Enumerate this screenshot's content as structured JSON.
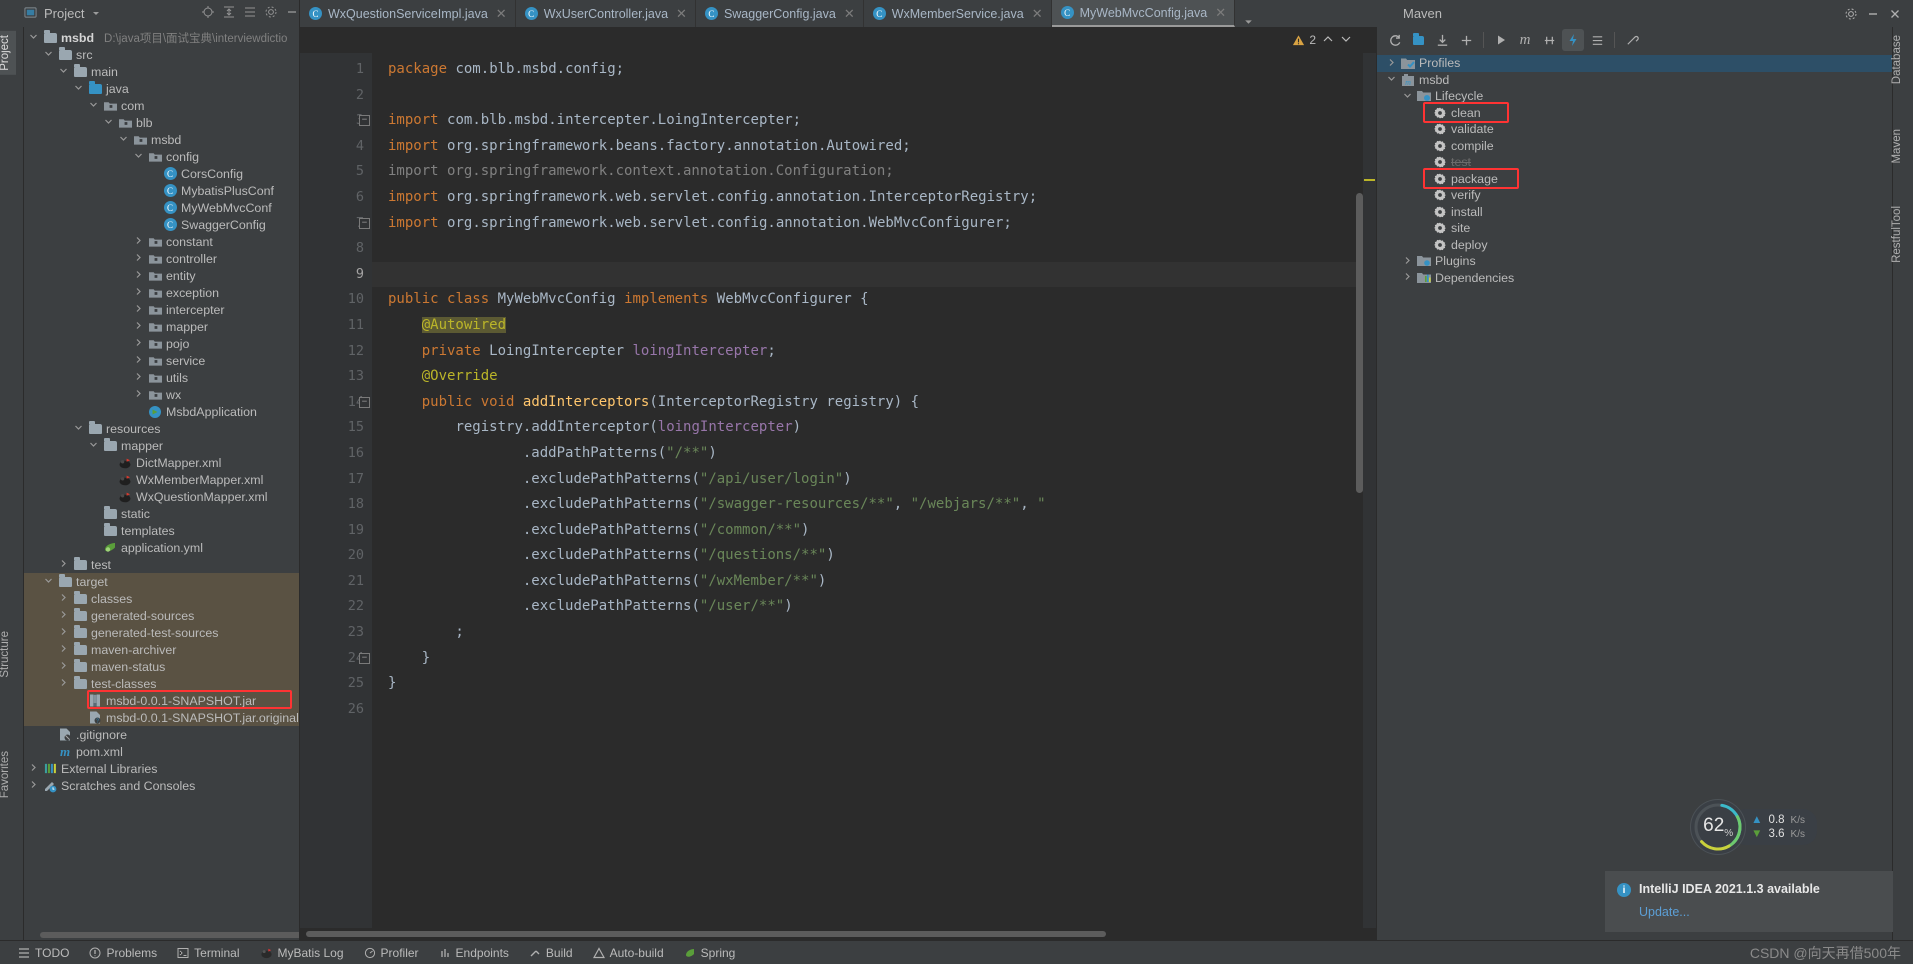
{
  "window": {
    "project_tool_title": "Project",
    "maven_tool_title": "Maven"
  },
  "project_toolbar": {
    "icons": [
      "locate-icon",
      "expand-all-icon",
      "collapse-all-icon",
      "settings-icon",
      "hide-icon"
    ]
  },
  "editor_tabs": [
    {
      "label": "WxQuestionServiceImpl.java",
      "active": false,
      "icon": "java-class-icon"
    },
    {
      "label": "WxUserController.java",
      "active": false,
      "icon": "java-class-icon"
    },
    {
      "label": "SwaggerConfig.java",
      "active": false,
      "icon": "java-class-icon"
    },
    {
      "label": "WxMemberService.java",
      "active": false,
      "icon": "java-interface-icon"
    },
    {
      "label": "MyWebMvcConfig.java",
      "active": true,
      "icon": "java-class-icon"
    }
  ],
  "editor": {
    "warning_count": "2",
    "lines": [
      {
        "n": "1",
        "current": false,
        "fold": null
      },
      {
        "n": "2",
        "current": false,
        "fold": null
      },
      {
        "n": "3",
        "current": false,
        "fold": "start"
      },
      {
        "n": "4",
        "current": false,
        "fold": null
      },
      {
        "n": "5",
        "current": false,
        "fold": null
      },
      {
        "n": "6",
        "current": false,
        "fold": null
      },
      {
        "n": "7",
        "current": false,
        "fold": "end"
      },
      {
        "n": "8",
        "current": false,
        "fold": null
      },
      {
        "n": "9",
        "current": true,
        "fold": null
      },
      {
        "n": "10",
        "current": false,
        "fold": null
      },
      {
        "n": "11",
        "current": false,
        "fold": null
      },
      {
        "n": "12",
        "current": false,
        "fold": null
      },
      {
        "n": "13",
        "current": false,
        "fold": null
      },
      {
        "n": "14",
        "current": false,
        "fold": "start"
      },
      {
        "n": "15",
        "current": false,
        "fold": null
      },
      {
        "n": "16",
        "current": false,
        "fold": null
      },
      {
        "n": "17",
        "current": false,
        "fold": null
      },
      {
        "n": "18",
        "current": false,
        "fold": null
      },
      {
        "n": "19",
        "current": false,
        "fold": null
      },
      {
        "n": "20",
        "current": false,
        "fold": null
      },
      {
        "n": "21",
        "current": false,
        "fold": null
      },
      {
        "n": "22",
        "current": false,
        "fold": null
      },
      {
        "n": "23",
        "current": false,
        "fold": null
      },
      {
        "n": "24",
        "current": false,
        "fold": "end"
      },
      {
        "n": "25",
        "current": false,
        "fold": null
      },
      {
        "n": "26",
        "current": false,
        "fold": null
      }
    ],
    "source_text": "package com.blb.msbd.config;\n\nimport com.blb.msbd.intercepter.LoingIntercepter;\nimport org.springframework.beans.factory.annotation.Autowired;\nimport org.springframework.context.annotation.Configuration;\nimport org.springframework.web.servlet.config.annotation.InterceptorRegistry;\nimport org.springframework.web.servlet.config.annotation.WebMvcConfigurer;\n\n\npublic class MyWebMvcConfig implements WebMvcConfigurer {\n    @Autowired\n    private LoingIntercepter loingIntercepter;\n    @Override\n    public void addInterceptors(InterceptorRegistry registry) {\n        registry.addInterceptor(loingIntercepter)\n                .addPathPatterns(\"/**\")\n                .excludePathPatterns(\"/api/user/login\")\n                .excludePathPatterns(\"/swagger-resources/**\", \"/webjars/**\", \"\n                .excludePathPatterns(\"/common/**\")\n                .excludePathPatterns(\"/questions/**\")\n                .excludePathPatterns(\"/wxMember/**\")\n                .excludePathPatterns(\"/user/**\")\n        ;\n    }\n}"
  },
  "project_tree": {
    "root_path": "D:\\java项目\\面试宝典\\interviewdictio",
    "items": [
      {
        "label": "msbd",
        "depth": 0,
        "arrow": "down",
        "icon": "module-folder-icon",
        "bold": true,
        "path": true
      },
      {
        "label": "src",
        "depth": 1,
        "arrow": "down",
        "icon": "folder-icon"
      },
      {
        "label": "main",
        "depth": 2,
        "arrow": "down",
        "icon": "folder-icon"
      },
      {
        "label": "java",
        "depth": 3,
        "arrow": "down",
        "icon": "source-folder-icon"
      },
      {
        "label": "com",
        "depth": 4,
        "arrow": "down",
        "icon": "package-icon"
      },
      {
        "label": "blb",
        "depth": 5,
        "arrow": "down",
        "icon": "package-icon"
      },
      {
        "label": "msbd",
        "depth": 6,
        "arrow": "down",
        "icon": "package-icon"
      },
      {
        "label": "config",
        "depth": 7,
        "arrow": "down",
        "icon": "package-icon"
      },
      {
        "label": "CorsConfig",
        "depth": 8,
        "arrow": "none",
        "icon": "java-class-icon"
      },
      {
        "label": "MybatisPlusConf",
        "depth": 8,
        "arrow": "none",
        "icon": "java-class-icon"
      },
      {
        "label": "MyWebMvcConf",
        "depth": 8,
        "arrow": "none",
        "icon": "java-class-icon"
      },
      {
        "label": "SwaggerConfig",
        "depth": 8,
        "arrow": "none",
        "icon": "java-class-icon"
      },
      {
        "label": "constant",
        "depth": 7,
        "arrow": "right",
        "icon": "package-icon"
      },
      {
        "label": "controller",
        "depth": 7,
        "arrow": "right",
        "icon": "package-icon"
      },
      {
        "label": "entity",
        "depth": 7,
        "arrow": "right",
        "icon": "package-icon"
      },
      {
        "label": "exception",
        "depth": 7,
        "arrow": "right",
        "icon": "package-icon"
      },
      {
        "label": "intercepter",
        "depth": 7,
        "arrow": "right",
        "icon": "package-icon"
      },
      {
        "label": "mapper",
        "depth": 7,
        "arrow": "right",
        "icon": "package-icon"
      },
      {
        "label": "pojo",
        "depth": 7,
        "arrow": "right",
        "icon": "package-icon"
      },
      {
        "label": "service",
        "depth": 7,
        "arrow": "right",
        "icon": "package-icon"
      },
      {
        "label": "utils",
        "depth": 7,
        "arrow": "right",
        "icon": "package-icon"
      },
      {
        "label": "wx",
        "depth": 7,
        "arrow": "right",
        "icon": "package-icon"
      },
      {
        "label": "MsbdApplication",
        "depth": 7,
        "arrow": "none",
        "icon": "spring-boot-run-icon"
      },
      {
        "label": "resources",
        "depth": 3,
        "arrow": "down",
        "icon": "resources-folder-icon"
      },
      {
        "label": "mapper",
        "depth": 4,
        "arrow": "down",
        "icon": "folder-icon"
      },
      {
        "label": "DictMapper.xml",
        "depth": 5,
        "arrow": "none",
        "icon": "mybatis-xml-icon"
      },
      {
        "label": "WxMemberMapper.xml",
        "depth": 5,
        "arrow": "none",
        "icon": "mybatis-xml-icon"
      },
      {
        "label": "WxQuestionMapper.xml",
        "depth": 5,
        "arrow": "none",
        "icon": "mybatis-xml-icon"
      },
      {
        "label": "static",
        "depth": 4,
        "arrow": "none",
        "icon": "folder-icon"
      },
      {
        "label": "templates",
        "depth": 4,
        "arrow": "none",
        "icon": "folder-icon"
      },
      {
        "label": "application.yml",
        "depth": 4,
        "arrow": "none",
        "icon": "yaml-spring-icon"
      },
      {
        "label": "test",
        "depth": 2,
        "arrow": "right",
        "icon": "folder-icon"
      },
      {
        "label": "target",
        "depth": 1,
        "arrow": "down",
        "icon": "folder-icon",
        "excluded": true
      },
      {
        "label": "classes",
        "depth": 2,
        "arrow": "right",
        "icon": "folder-icon",
        "excluded": true
      },
      {
        "label": "generated-sources",
        "depth": 2,
        "arrow": "right",
        "icon": "folder-icon",
        "excluded": true
      },
      {
        "label": "generated-test-sources",
        "depth": 2,
        "arrow": "right",
        "icon": "folder-icon",
        "excluded": true
      },
      {
        "label": "maven-archiver",
        "depth": 2,
        "arrow": "right",
        "icon": "folder-icon",
        "excluded": true
      },
      {
        "label": "maven-status",
        "depth": 2,
        "arrow": "right",
        "icon": "folder-icon",
        "excluded": true
      },
      {
        "label": "test-classes",
        "depth": 2,
        "arrow": "right",
        "icon": "folder-icon",
        "excluded": true
      },
      {
        "label": "msbd-0.0.1-SNAPSHOT.jar",
        "depth": 3,
        "arrow": "none",
        "icon": "jar-icon",
        "excluded": true,
        "highlight": true
      },
      {
        "label": "msbd-0.0.1-SNAPSHOT.jar.original",
        "depth": 3,
        "arrow": "none",
        "icon": "file-unknown-icon",
        "excluded": true
      },
      {
        "label": ".gitignore",
        "depth": 1,
        "arrow": "none",
        "icon": "gitignore-icon"
      },
      {
        "label": "pom.xml",
        "depth": 1,
        "arrow": "none",
        "icon": "maven-pom-icon"
      },
      {
        "label": "External Libraries",
        "depth": 0,
        "arrow": "right",
        "icon": "libraries-icon"
      },
      {
        "label": "Scratches and Consoles",
        "depth": 0,
        "arrow": "right",
        "icon": "scratches-icon"
      }
    ]
  },
  "maven_panel": {
    "toolbar_icons": [
      "reimport-icon",
      "generate-sources-icon",
      "download-sources-icon",
      "add-icon",
      "run-icon",
      "maven-build-icon",
      "skip-tests-icon",
      "toggle-offline-icon",
      "collapse-all-icon",
      "settings-icon"
    ],
    "tree": [
      {
        "label": "Profiles",
        "depth": 0,
        "arrow": "right",
        "icon": "profiles-icon",
        "selected": true
      },
      {
        "label": "msbd",
        "depth": 0,
        "arrow": "down",
        "icon": "maven-project-icon"
      },
      {
        "label": "Lifecycle",
        "depth": 1,
        "arrow": "down",
        "icon": "lifecycle-folder-icon"
      },
      {
        "label": "clean",
        "depth": 2,
        "arrow": "none",
        "icon": "maven-goal-icon",
        "highlight": true
      },
      {
        "label": "validate",
        "depth": 2,
        "arrow": "none",
        "icon": "maven-goal-icon"
      },
      {
        "label": "compile",
        "depth": 2,
        "arrow": "none",
        "icon": "maven-goal-icon"
      },
      {
        "label": "test",
        "depth": 2,
        "arrow": "none",
        "icon": "maven-goal-icon",
        "muted": true
      },
      {
        "label": "package",
        "depth": 2,
        "arrow": "none",
        "icon": "maven-goal-icon",
        "highlight": true
      },
      {
        "label": "verify",
        "depth": 2,
        "arrow": "none",
        "icon": "maven-goal-icon"
      },
      {
        "label": "install",
        "depth": 2,
        "arrow": "none",
        "icon": "maven-goal-icon"
      },
      {
        "label": "site",
        "depth": 2,
        "arrow": "none",
        "icon": "maven-goal-icon"
      },
      {
        "label": "deploy",
        "depth": 2,
        "arrow": "none",
        "icon": "maven-goal-icon"
      },
      {
        "label": "Plugins",
        "depth": 1,
        "arrow": "right",
        "icon": "plugins-folder-icon"
      },
      {
        "label": "Dependencies",
        "depth": 1,
        "arrow": "right",
        "icon": "dependencies-folder-icon"
      }
    ]
  },
  "left_strip": {
    "labels": [
      "Project",
      "Structure",
      "Favorites"
    ]
  },
  "right_strip": {
    "labels": [
      "Database",
      "Maven",
      "RestfulTool"
    ]
  },
  "status_bar": {
    "items": [
      {
        "label": "TODO",
        "icon": "todo-icon"
      },
      {
        "label": "Problems",
        "icon": "problems-icon"
      },
      {
        "label": "Terminal",
        "icon": "terminal-icon"
      },
      {
        "label": "MyBatis Log",
        "icon": "mybatis-icon"
      },
      {
        "label": "Profiler",
        "icon": "profiler-icon"
      },
      {
        "label": "Endpoints",
        "icon": "endpoints-icon"
      },
      {
        "label": "Build",
        "icon": "build-icon"
      },
      {
        "label": "Auto-build",
        "icon": "auto-build-icon"
      },
      {
        "label": "Spring",
        "icon": "spring-icon"
      }
    ],
    "watermark": "CSDN @向天再借500年"
  },
  "memory_widget": {
    "percent": "62",
    "percent_suffix": "%",
    "upload": "0.8",
    "upload_unit": "K/s",
    "download": "3.6",
    "download_unit": "K/s"
  },
  "notification": {
    "message": "IntelliJ IDEA 2021.1.3 available",
    "action": "Update...",
    "icon": "info-icon"
  },
  "colors": {
    "accent": "#3592c4",
    "highlight_box": "#ff3333",
    "excluded_bg": "#5a5243",
    "selection": "#2d4f67"
  }
}
